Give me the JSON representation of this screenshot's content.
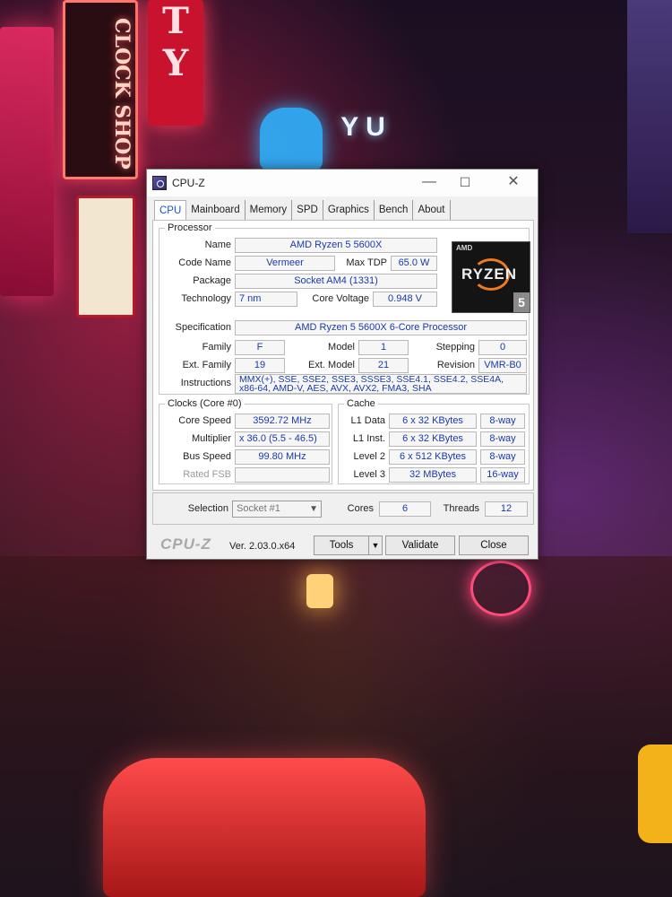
{
  "background": {
    "sign_clock_text": "CLOCK SHOP",
    "sign_ty_text": [
      "T",
      "Y"
    ],
    "neon_yu_text": "Y U"
  },
  "window": {
    "title": "CPU-Z",
    "tabs": [
      "CPU",
      "Mainboard",
      "Memory",
      "SPD",
      "Graphics",
      "Bench",
      "About"
    ],
    "active_tab": "CPU"
  },
  "processor": {
    "legend": "Processor",
    "name_label": "Name",
    "name": "AMD Ryzen 5 5600X",
    "code_name_label": "Code Name",
    "code_name": "Vermeer",
    "max_tdp_label": "Max TDP",
    "max_tdp": "65.0 W",
    "package_label": "Package",
    "package": "Socket AM4 (1331)",
    "technology_label": "Technology",
    "technology": "7 nm",
    "core_voltage_label": "Core Voltage",
    "core_voltage": "0.948 V",
    "specification_label": "Specification",
    "specification": "AMD Ryzen 5 5600X 6-Core Processor",
    "family_label": "Family",
    "family": "F",
    "model_label": "Model",
    "model": "1",
    "stepping_label": "Stepping",
    "stepping": "0",
    "ext_family_label": "Ext. Family",
    "ext_family": "19",
    "ext_model_label": "Ext. Model",
    "ext_model": "21",
    "revision_label": "Revision",
    "revision": "VMR-B0",
    "instructions_label": "Instructions",
    "instructions": "MMX(+), SSE, SSE2, SSE3, SSSE3, SSE4.1, SSE4.2, SSE4A, x86-64, AMD-V, AES, AVX, AVX2, FMA3, SHA",
    "badge": {
      "brand": "AMD",
      "word": "RYZEN",
      "tier": "5"
    }
  },
  "clocks": {
    "legend": "Clocks (Core #0)",
    "core_speed_label": "Core Speed",
    "core_speed": "3592.72 MHz",
    "multiplier_label": "Multiplier",
    "multiplier": "x 36.0 (5.5 - 46.5)",
    "bus_speed_label": "Bus Speed",
    "bus_speed": "99.80 MHz",
    "rated_fsb_label": "Rated FSB",
    "rated_fsb": ""
  },
  "cache": {
    "legend": "Cache",
    "rows": [
      {
        "label": "L1 Data",
        "size": "6 x 32 KBytes",
        "ways": "8-way"
      },
      {
        "label": "L1 Inst.",
        "size": "6 x 32 KBytes",
        "ways": "8-way"
      },
      {
        "label": "Level 2",
        "size": "6 x 512 KBytes",
        "ways": "8-way"
      },
      {
        "label": "Level 3",
        "size": "32 MBytes",
        "ways": "16-way"
      }
    ]
  },
  "selection": {
    "label": "Selection",
    "value": "Socket #1",
    "cores_label": "Cores",
    "cores": "6",
    "threads_label": "Threads",
    "threads": "12"
  },
  "footer": {
    "brand": "CPU-Z",
    "version": "Ver. 2.03.0.x64",
    "tools_label": "Tools",
    "validate_label": "Validate",
    "close_label": "Close"
  }
}
